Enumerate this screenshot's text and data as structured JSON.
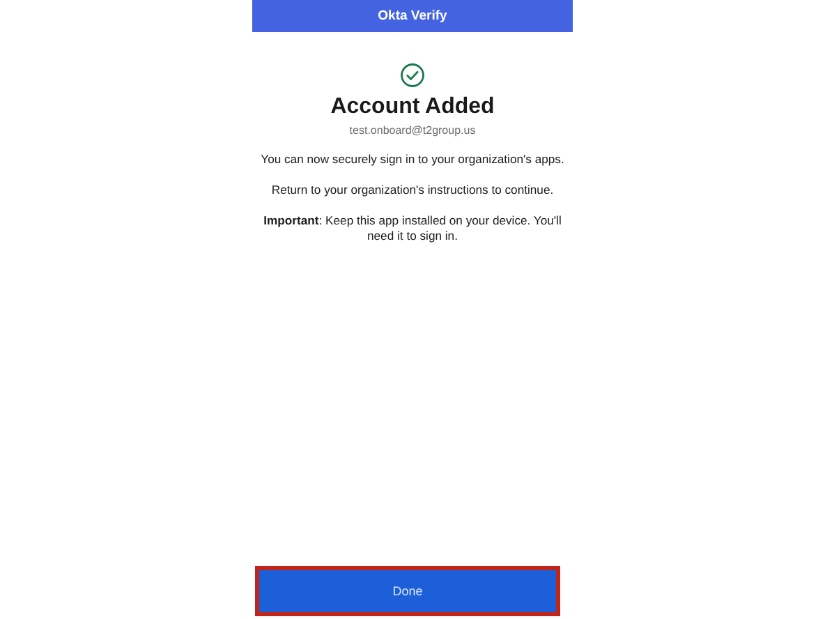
{
  "header": {
    "title": "Okta Verify"
  },
  "status": {
    "kind": "success"
  },
  "title": "Account Added",
  "account": "test.onboard@t2group.us",
  "paragraphs": [
    {
      "text": "You can now securely sign in to your organization's apps."
    },
    {
      "text": "Return to your organization's instructions to continue."
    },
    {
      "text": "**Important**: Keep this app installed on your device. You'll need it to sign in."
    }
  ],
  "button": {
    "label": "Done",
    "highlighted": true
  }
}
